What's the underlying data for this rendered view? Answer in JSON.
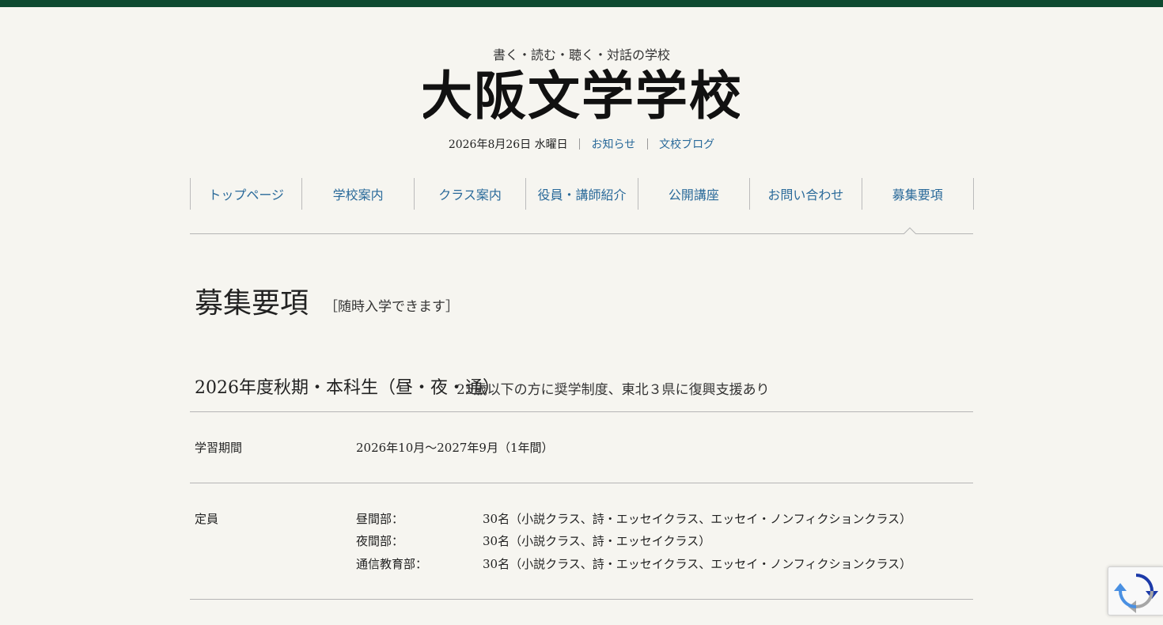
{
  "header": {
    "tagline": "書く・読む・聴く・対話の学校",
    "logo_text": "大阪文学学校",
    "date": "2026年8月26日 水曜日",
    "links": [
      "お知らせ",
      "文校ブログ"
    ]
  },
  "nav": {
    "items": [
      "トップページ",
      "学校案内",
      "クラス案内",
      "役員・講師紹介",
      "公開講座",
      "お問い合わせ",
      "募集要項"
    ],
    "active": "募集要項"
  },
  "page": {
    "title": "募集要項",
    "subtitle": "［随時入学できます］"
  },
  "section": {
    "title": "2026年度秋期・本科生（昼・夜・通）",
    "note": "25歳以下の方に奨学制度、東北３県に復興支援あり"
  },
  "rows": {
    "period": {
      "label": "学習期間",
      "value": "2026年10月～2027年9月（1年間）"
    },
    "capacity": {
      "label": "定員",
      "items": [
        {
          "label": "昼間部：",
          "value": "30名（小説クラス、詩・エッセイクラス、エッセイ・ノンフィクションクラス）"
        },
        {
          "label": "夜間部：",
          "value": "30名（小説クラス、詩・エッセイクラス）"
        },
        {
          "label": "通信教育部：",
          "value": "30名（小説クラス、詩・エッセイクラス、エッセイ・ノンフィクションクラス）"
        }
      ]
    }
  },
  "colors": {
    "topbar": "#0e4a30",
    "link": "#2a6a9a",
    "background": "#f6f5f0"
  },
  "icons": {
    "recaptcha": "recaptcha-icon"
  }
}
